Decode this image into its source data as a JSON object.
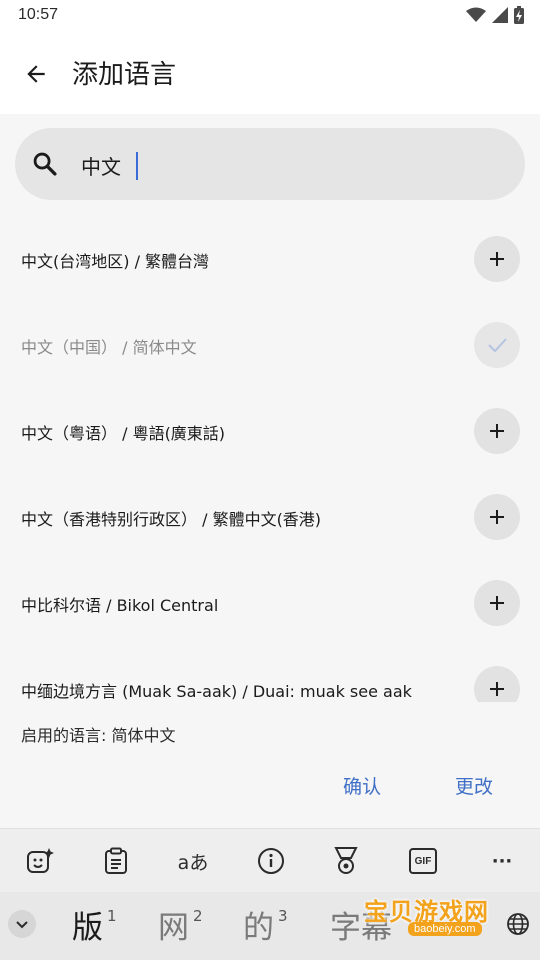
{
  "status_bar": {
    "time": "10:57",
    "icons": [
      "wifi-icon",
      "signal-icon",
      "battery-charging-icon"
    ]
  },
  "app_bar": {
    "title": "添加语言",
    "back_icon": "arrow-left-icon"
  },
  "search": {
    "value": "中文",
    "icon": "search-icon"
  },
  "languages": [
    {
      "label": "中文(台湾地区) / 繁體台灣",
      "state": "add",
      "icon": "plus-icon"
    },
    {
      "label": "中文（中国） / 简体中文",
      "state": "added",
      "icon": "check-icon"
    },
    {
      "label": "中文（粤语） / 粵語(廣東話)",
      "state": "add",
      "icon": "plus-icon"
    },
    {
      "label": "中文（香港特别行政区） / 繁體中文(香港)",
      "state": "add",
      "icon": "plus-icon"
    },
    {
      "label": "中比科尔语 / Bikol Central",
      "state": "add",
      "icon": "plus-icon"
    },
    {
      "label": "中缅边境方言 (Muak Sa-aak) / Duai: muak see aak",
      "state": "add",
      "icon": "plus-icon"
    }
  ],
  "enabled": {
    "text": "启用的语言: 简体中文"
  },
  "actions": {
    "confirm": "确认",
    "change": "更改"
  },
  "keyboard_toolbar": {
    "tools": [
      {
        "name": "emoji-sparkle-icon",
        "glyph": ""
      },
      {
        "name": "clipboard-icon",
        "glyph": ""
      },
      {
        "name": "translate-icon",
        "glyph": "aあ"
      },
      {
        "name": "info-icon",
        "glyph": ""
      },
      {
        "name": "medal-icon",
        "glyph": ""
      },
      {
        "name": "gif-icon",
        "glyph": "GIF"
      },
      {
        "name": "more-icon",
        "glyph": "···"
      }
    ]
  },
  "candidates": [
    {
      "text": "版",
      "index": "1"
    },
    {
      "text": "网",
      "index": "2"
    },
    {
      "text": "的",
      "index": "3"
    },
    {
      "text": "字幕",
      "index": ""
    }
  ],
  "watermark": {
    "title": "宝贝游戏网",
    "url": "baobeiy.com"
  },
  "colors": {
    "accent": "#3f6fc6",
    "caret": "#3b6bd6",
    "watermark": "#f2a21b"
  }
}
